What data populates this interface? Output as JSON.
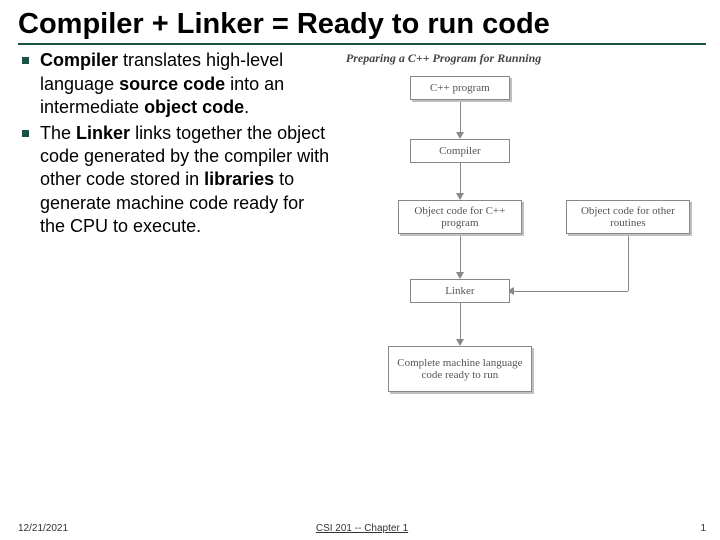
{
  "title": "Compiler + Linker = Ready to run code",
  "bullets": [
    "<b>Compiler</b> translates high-level language <b>source code</b> into an intermediate <b>object code</b>.",
    "The <b>Linker</b> links together the object code generated by the compiler with other code stored in <b>libraries</b> to generate machine code ready for the CPU to execute."
  ],
  "diagram": {
    "header": "Preparing a C++ Program for Running",
    "box_cpp": "C++ program",
    "box_compiler": "Compiler",
    "box_obj_cpp": "Object code for\nC++ program",
    "box_obj_other": "Object code for\nother routines",
    "box_linker": "Linker",
    "box_result": "Complete machine\nlanguage code\nready to run"
  },
  "footer": {
    "date": "12/21/2021",
    "center": "CSI 201 -- Chapter 1",
    "page": "1"
  }
}
